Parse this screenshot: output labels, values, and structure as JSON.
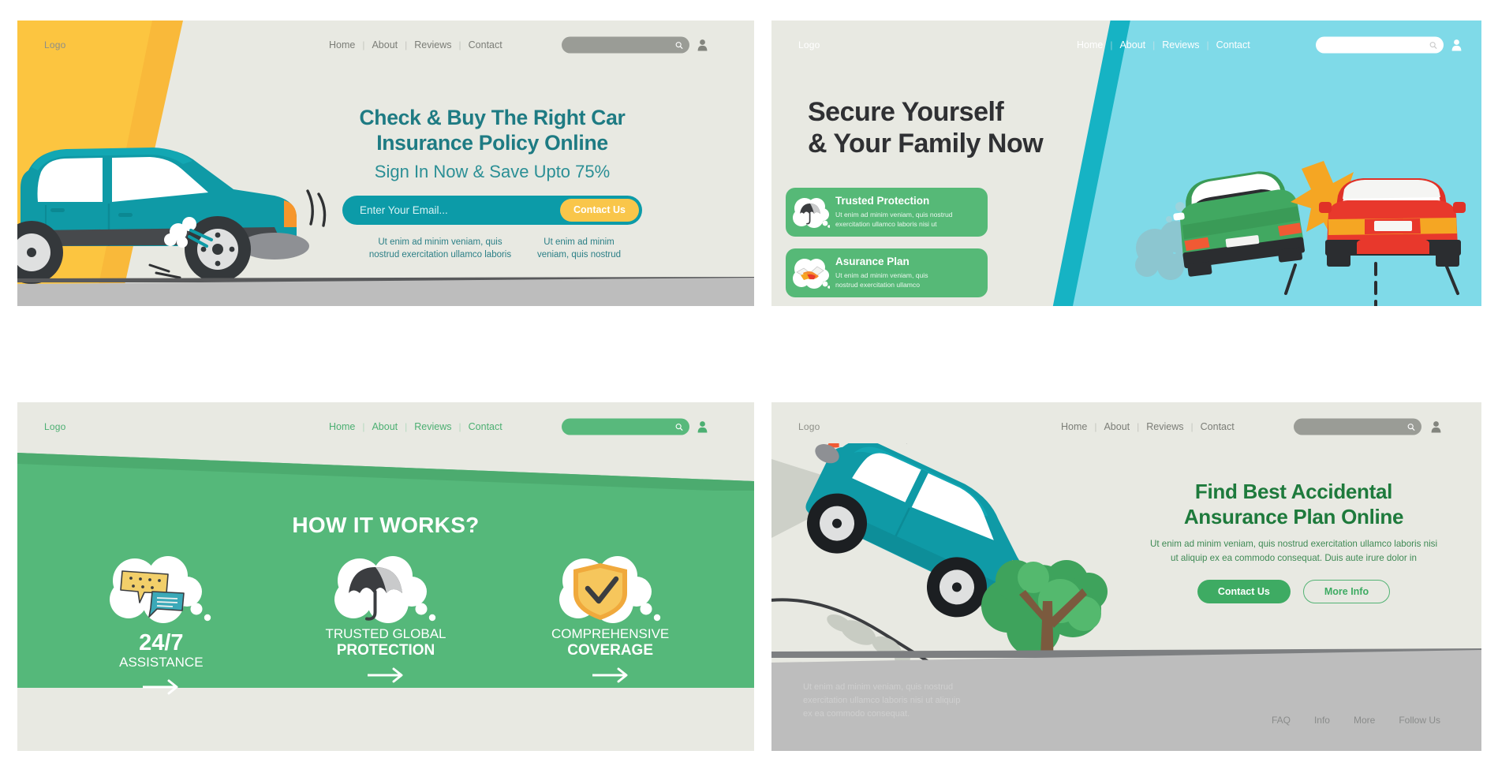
{
  "nav": {
    "logo": "Logo",
    "links": [
      "Home",
      "About",
      "Reviews",
      "Contact"
    ],
    "separator": "|",
    "search_icon": "search-icon",
    "avatar_icon": "user-avatar-icon"
  },
  "colors": {
    "panel_bg": "#e8e9e2",
    "teal": "#0c9ba8",
    "teal_dark": "#1e7b83",
    "yellow": "#fcc540",
    "cta_yellow": "#f9c64a",
    "green": "#55b87a",
    "green_dark": "#1e7a3c",
    "cyan": "#7fdae8",
    "cyan_stripe": "#16b3c4",
    "grey_road": "#bdbdbd",
    "card_green": "#56b977"
  },
  "panel1": {
    "title_line1": "Check & Buy The Right Car",
    "title_line2": "Insurance Policy Online",
    "subtitle": "Sign In Now & Save Upto 75%",
    "email_placeholder": "Enter Your Email...",
    "email_value": "",
    "cta_label": "Contact Us",
    "note_left": "Ut enim ad minim veniam, quis nostrud exercitation ullamco laboris",
    "note_right": "Ut enim ad minim veniam, quis nostrud",
    "illustration": "teal-car-flat-tire"
  },
  "panel2": {
    "title_line1": "Secure Yourself",
    "title_line2": "& Your Family Now",
    "cards": [
      {
        "icon": "umbrella-icon",
        "title": "Trusted Protection",
        "desc_line1": "Ut enim ad minim veniam, quis nostrud",
        "desc_line2": "exercitation ullamco laboris nisi ut"
      },
      {
        "icon": "handshake-icon",
        "title": "Asurance Plan",
        "desc_line1": "Ut enim ad minim veniam, quis",
        "desc_line2": "nostrud exercitation ullamco"
      }
    ],
    "illustration": "two-car-collision"
  },
  "panel3": {
    "title": "HOW IT WORKS?",
    "features": [
      {
        "icon": "chat-bubbles-icon",
        "line1": "24/7",
        "line2": "ASSISTANCE",
        "line1_style": "big",
        "arrow": "arrow-right-icon"
      },
      {
        "icon": "umbrella-icon",
        "line1": "TRUSTED GLOBAL",
        "line2": "PROTECTION",
        "line1_style": "small",
        "arrow": "arrow-right-icon"
      },
      {
        "icon": "shield-check-icon",
        "line1": "COMPREHENSIVE",
        "line2": "COVERAGE",
        "line1_style": "small",
        "arrow": "arrow-right-icon"
      }
    ]
  },
  "panel4": {
    "title_line1": "Find Best Accidental",
    "title_line2": "Ansurance Plan Online",
    "desc": "Ut enim ad minim veniam, quis nostrud exercitation ullamco laboris nisi ut aliquip ex ea commodo consequat. Duis aute irure dolor in",
    "primary_button": "Contact Us",
    "secondary_button": "More Info",
    "grey_text": "Ut enim ad minim veniam, quis nostrud exercitation ullamco laboris nisi ut aliquip ex ea commodo consequat.",
    "footer_links": [
      "FAQ",
      "Info",
      "More",
      "Follow Us"
    ],
    "illustration": "teal-car-on-slope-with-tree"
  }
}
